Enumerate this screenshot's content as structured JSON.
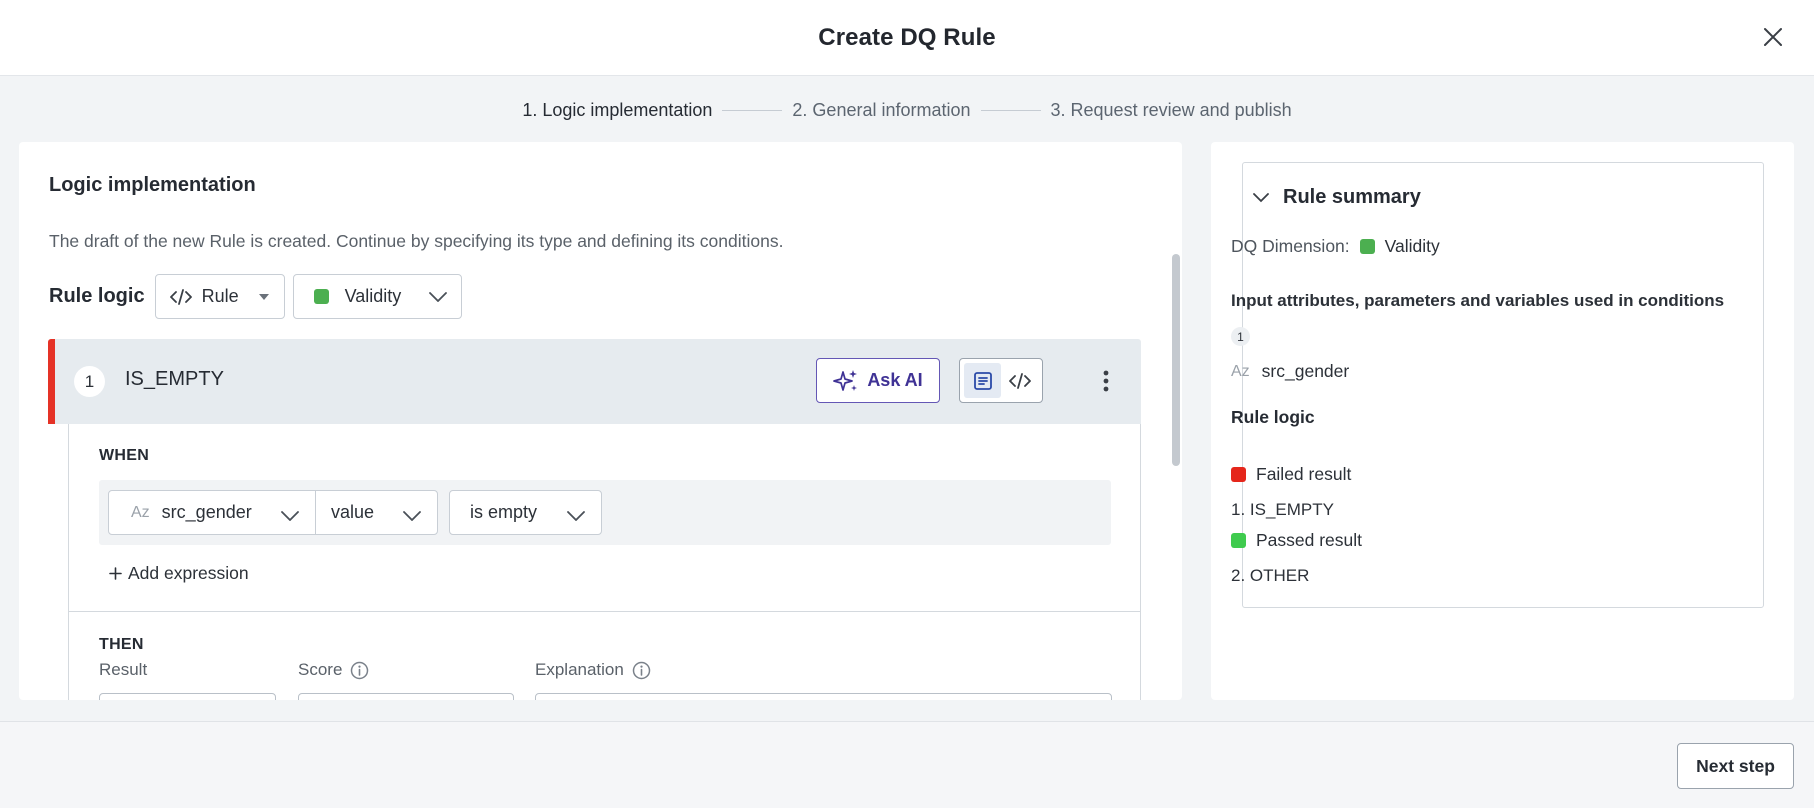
{
  "dialog": {
    "title": "Create DQ Rule"
  },
  "stepper": {
    "steps": [
      {
        "label": "1. Logic implementation",
        "active": true
      },
      {
        "label": "2. General information",
        "active": false
      },
      {
        "label": "3. Request review and publish",
        "active": false
      }
    ]
  },
  "logic": {
    "title": "Logic implementation",
    "description": "The draft of the new Rule is created. Continue by specifying its type and defining its conditions.",
    "rule_logic_label": "Rule logic",
    "type_select": "Rule",
    "dimension_select": "Validity",
    "dimension_color": "#4caf50"
  },
  "condition": {
    "number": "1",
    "name": "IS_EMPTY",
    "marker_color": "#e53226",
    "ask_ai_label": "Ask AI",
    "when_label": "WHEN",
    "expression": {
      "attribute_type": "Az",
      "attribute": "src_gender",
      "function": "value",
      "operator": "is empty"
    },
    "add_expression_label": "Add expression",
    "then_label": "THEN",
    "result_label": "Result",
    "score_label": "Score",
    "explanation_label": "Explanation"
  },
  "summary": {
    "title": "Rule summary",
    "dimension_label": "DQ Dimension:",
    "dimension_value": "Validity",
    "dimension_color": "#4caf50",
    "inputs_title": "Input attributes, parameters and variables used in conditions",
    "inputs_count": "1",
    "inputs": [
      {
        "type": "Az",
        "name": "src_gender"
      }
    ],
    "rule_logic_title": "Rule logic",
    "results": [
      {
        "label": "Failed result",
        "color": "#e5261b",
        "condition": "1. IS_EMPTY"
      },
      {
        "label": "Passed result",
        "color": "#3fcb4e",
        "condition": "2. OTHER"
      }
    ]
  },
  "footer": {
    "next_label": "Next step"
  }
}
